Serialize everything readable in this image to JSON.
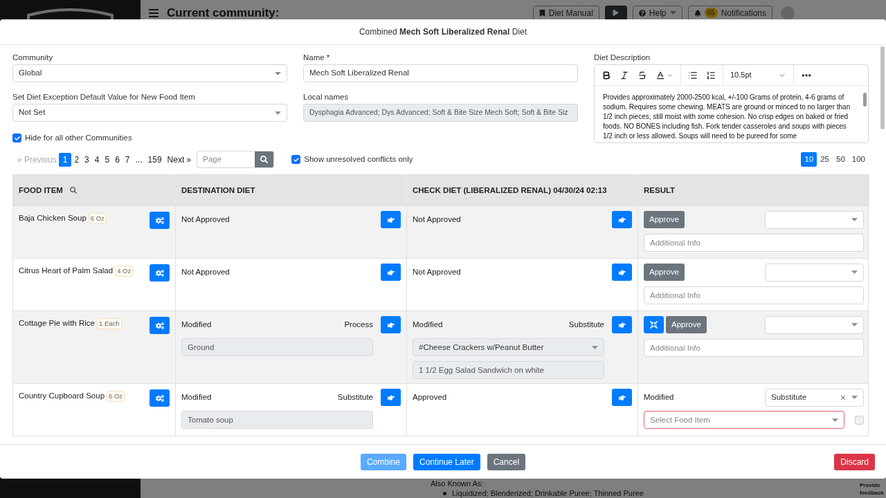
{
  "background": {
    "header": {
      "title": "Current community:",
      "buttons": [
        {
          "kind": "manual",
          "label": "Diet Manual"
        },
        {
          "kind": "play"
        },
        {
          "kind": "help",
          "label": "Help"
        },
        {
          "kind": "notifications",
          "label": "Notifications",
          "count": "65"
        }
      ]
    },
    "page_heading": "Also Known As:",
    "page_bullet": "Liquidized; Blenderized; Drinkable Puree; Thinned Puree",
    "feedback": "Provide feedback"
  },
  "modal": {
    "title": "Combined **Mech Soft Liberalized Renal** Diet",
    "form": {
      "community": {
        "label": "Community",
        "value": "Global"
      },
      "exception": {
        "label": "Set Diet Exception Default Value for New Food Item",
        "value": "Not Set"
      },
      "hide": {
        "label": "Hide for all other Communities",
        "checked": true
      },
      "name": {
        "label": "Name *",
        "value": "Mech Soft Liberalized Renal"
      },
      "local_names": {
        "label": "Local names",
        "value": "Dysphagia Advanced; Dys Advanced; Soft & Bite Size Mech Soft; Soft & Bite Siz"
      },
      "description": {
        "label": "Diet Description",
        "font_size": "10.5pt",
        "text": "Provides approximately 2000-2500 kcal, +/-100 Grams of protein, 4-6 grams of sodium. Requires some chewing. MEATS are ground or minced to no larger than 1/2 inch pieces, still moist with some cohesion. No crisp edges on baked or fried foods. NO BONES including fish. Fork tender casseroles and soups with pieces 1/2 inch or less allowed. Soups will need to be pureed for some"
      }
    },
    "pagination": {
      "previous": {
        "label": "« Previous",
        "disabled": true
      },
      "pages": [
        {
          "kind": "page",
          "label": "1",
          "selected": true
        },
        {
          "kind": "page",
          "label": "2",
          "selected": false
        },
        {
          "kind": "page",
          "label": "3",
          "selected": false
        },
        {
          "kind": "page",
          "label": "4",
          "selected": false
        },
        {
          "kind": "page",
          "label": "5",
          "selected": false
        },
        {
          "kind": "page",
          "label": "6",
          "selected": false
        },
        {
          "kind": "page",
          "label": "7",
          "selected": false
        },
        {
          "kind": "ellipsis",
          "label": "..."
        },
        {
          "kind": "page",
          "label": "159",
          "selected": false
        }
      ],
      "next": "Next »",
      "search_placeholder": "Page"
    },
    "unresolved": {
      "label": "Show unresolved conflicts only",
      "checked": true
    },
    "page_sizes": [
      {
        "label": "10",
        "selected": true
      },
      {
        "label": "25",
        "selected": false
      },
      {
        "label": "50",
        "selected": false
      },
      {
        "label": "100",
        "selected": false
      }
    ],
    "table": {
      "columns": [
        "FOOD ITEM",
        "DESTINATION DIET",
        "CHECK DIET (LIBERALIZED RENAL) 04/30/24 02:13",
        "RESULT"
      ],
      "rows": [
        {
          "name": "Baja Chicken Soup",
          "portion": "6 Oz",
          "destination": {
            "status": "Not Approved"
          },
          "check": {
            "status": "Not Approved"
          },
          "result": {
            "kind": "approve",
            "approve": "Approve",
            "info_placeholder": "Additional Info"
          }
        },
        {
          "name": "Citrus Heart of Palm Salad",
          "portion": "4 Oz",
          "destination": {
            "status": "Not Approved"
          },
          "check": {
            "status": "Not Approved"
          },
          "result": {
            "kind": "approve",
            "approve": "Approve",
            "info_placeholder": "Additional Info"
          }
        },
        {
          "name": "Cottage Pie with Rice",
          "portion": "1 Each",
          "destination": {
            "status": "Modified",
            "action": "Process",
            "fields": [
              {
                "kind": "input",
                "value": "Ground"
              }
            ]
          },
          "check": {
            "status": "Modified",
            "action": "Substitute",
            "fields": [
              {
                "kind": "select",
                "value": "#Cheese Crackers w/Peanut Butter"
              },
              {
                "kind": "input",
                "value": "1 1/2 Egg Salad Sandwich on white"
              }
            ]
          },
          "result": {
            "kind": "approve",
            "compare": true,
            "approve": "Approve",
            "info_placeholder": "Additional Info"
          }
        },
        {
          "name": "Country Cupboard Soup",
          "portion": "6 Oz",
          "destination": {
            "status": "Modified",
            "action": "Substitute",
            "fields": [
              {
                "kind": "input",
                "value": "Tomato soup"
              }
            ]
          },
          "check": {
            "status": "Approved"
          },
          "result": {
            "kind": "modified",
            "status": "Modified",
            "choice": "Substitute",
            "clear_symbol": "×",
            "food_placeholder": "Select Food Item",
            "invalid": true,
            "checked": false
          }
        }
      ]
    },
    "footer": {
      "buttons": [
        {
          "kind": "primary",
          "label": "Combine",
          "disabled": true
        },
        {
          "kind": "primary",
          "label": "Continue Later",
          "disabled": false
        },
        {
          "kind": "secondary",
          "label": "Cancel",
          "disabled": false
        }
      ],
      "discard": "Discard"
    }
  }
}
